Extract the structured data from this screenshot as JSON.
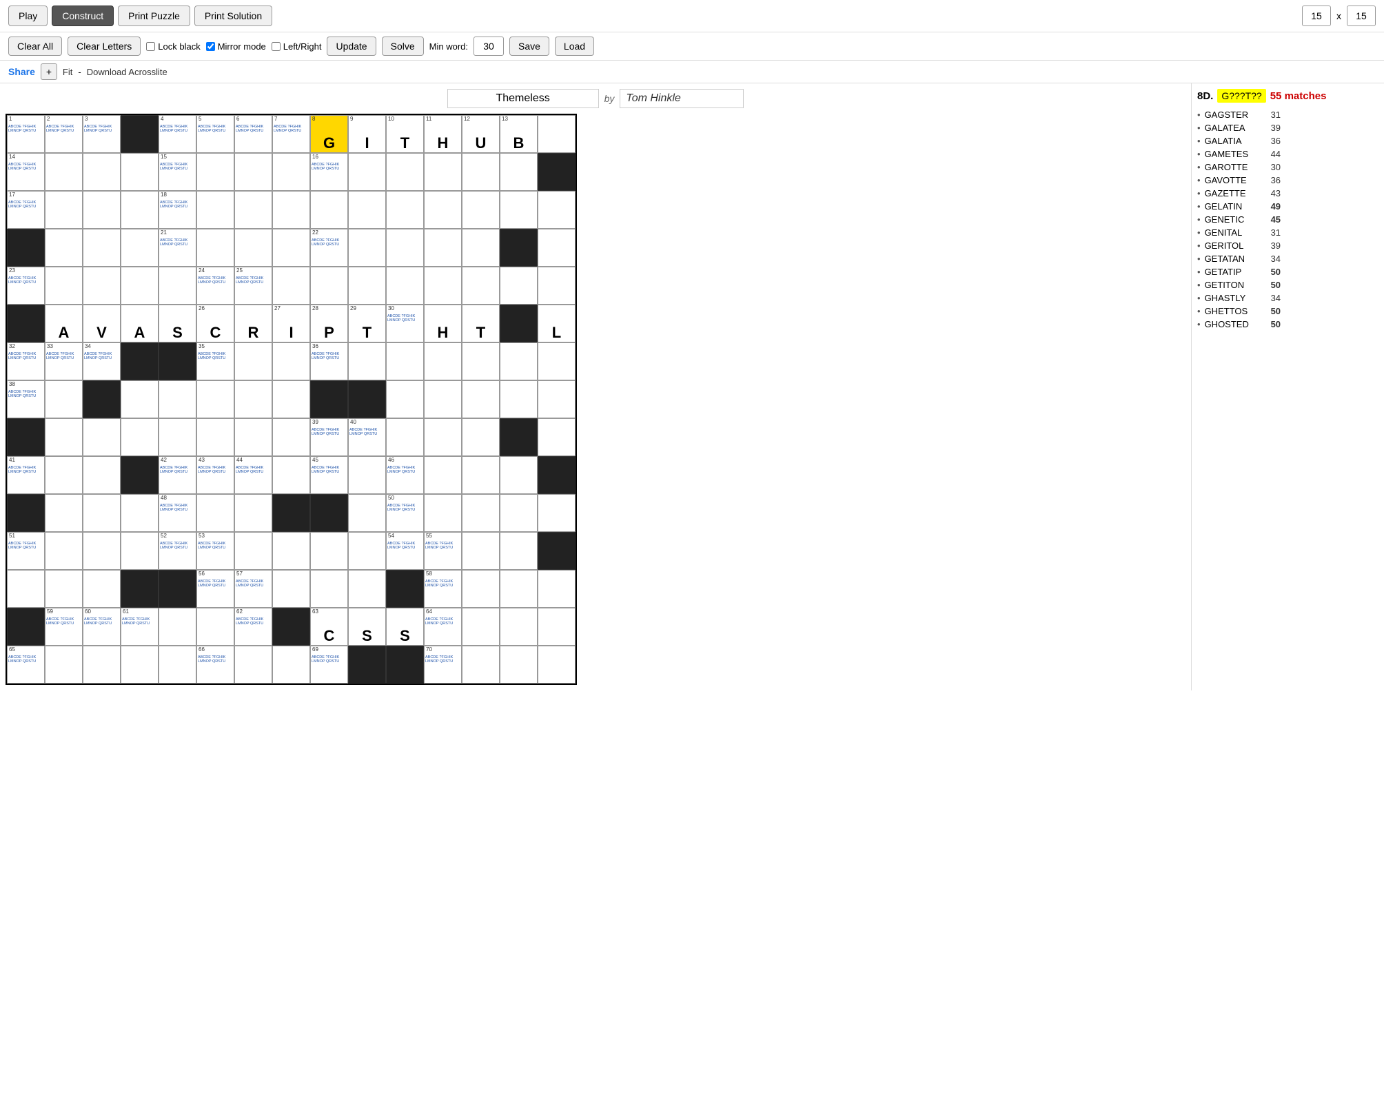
{
  "toolbar": {
    "play_label": "Play",
    "construct_label": "Construct",
    "print_puzzle_label": "Print Puzzle",
    "print_solution_label": "Print Solution",
    "width_value": "15",
    "height_value": "15",
    "x_label": "x"
  },
  "toolbar2": {
    "clear_all_label": "Clear All",
    "clear_letters_label": "Clear Letters",
    "lock_black_label": "Lock black",
    "mirror_mode_label": "Mirror mode",
    "left_right_label": "Left/Right",
    "update_label": "Update",
    "solve_label": "Solve",
    "min_word_label": "Min word:",
    "min_word_value": "30",
    "save_label": "Save",
    "load_label": "Load"
  },
  "toolbar3": {
    "share_label": "Share",
    "plus_label": "+",
    "fit_label": "Fit",
    "minus_label": "-",
    "download_label": "Download Acrosslite"
  },
  "puzzle": {
    "title": "Themeless",
    "by_label": "by",
    "author": "Tom Hinkle"
  },
  "sidebar": {
    "clue_number": "8D.",
    "clue_pattern": "G???T??",
    "match_label": "55 matches",
    "words": [
      {
        "name": "GAGSTER",
        "score": "31",
        "bold": false
      },
      {
        "name": "GALATEA",
        "score": "39",
        "bold": false
      },
      {
        "name": "GALATIA",
        "score": "36",
        "bold": false
      },
      {
        "name": "GAMETES",
        "score": "44",
        "bold": false
      },
      {
        "name": "GAROTTE",
        "score": "30",
        "bold": false
      },
      {
        "name": "GAVOTTE",
        "score": "36",
        "bold": false
      },
      {
        "name": "GAZETTE",
        "score": "43",
        "bold": false
      },
      {
        "name": "GELATIN",
        "score": "49",
        "bold": true
      },
      {
        "name": "GENETIC",
        "score": "45",
        "bold": true
      },
      {
        "name": "GENITAL",
        "score": "31",
        "bold": false
      },
      {
        "name": "GERITOL",
        "score": "39",
        "bold": false
      },
      {
        "name": "GETATAN",
        "score": "34",
        "bold": false
      },
      {
        "name": "GETATIP",
        "score": "50",
        "bold": true
      },
      {
        "name": "GETITON",
        "score": "50",
        "bold": true
      },
      {
        "name": "GHASTLY",
        "score": "34",
        "bold": false
      },
      {
        "name": "GHETTOS",
        "score": "50",
        "bold": true
      },
      {
        "name": "GHOSTED",
        "score": "50",
        "bold": true
      }
    ]
  }
}
